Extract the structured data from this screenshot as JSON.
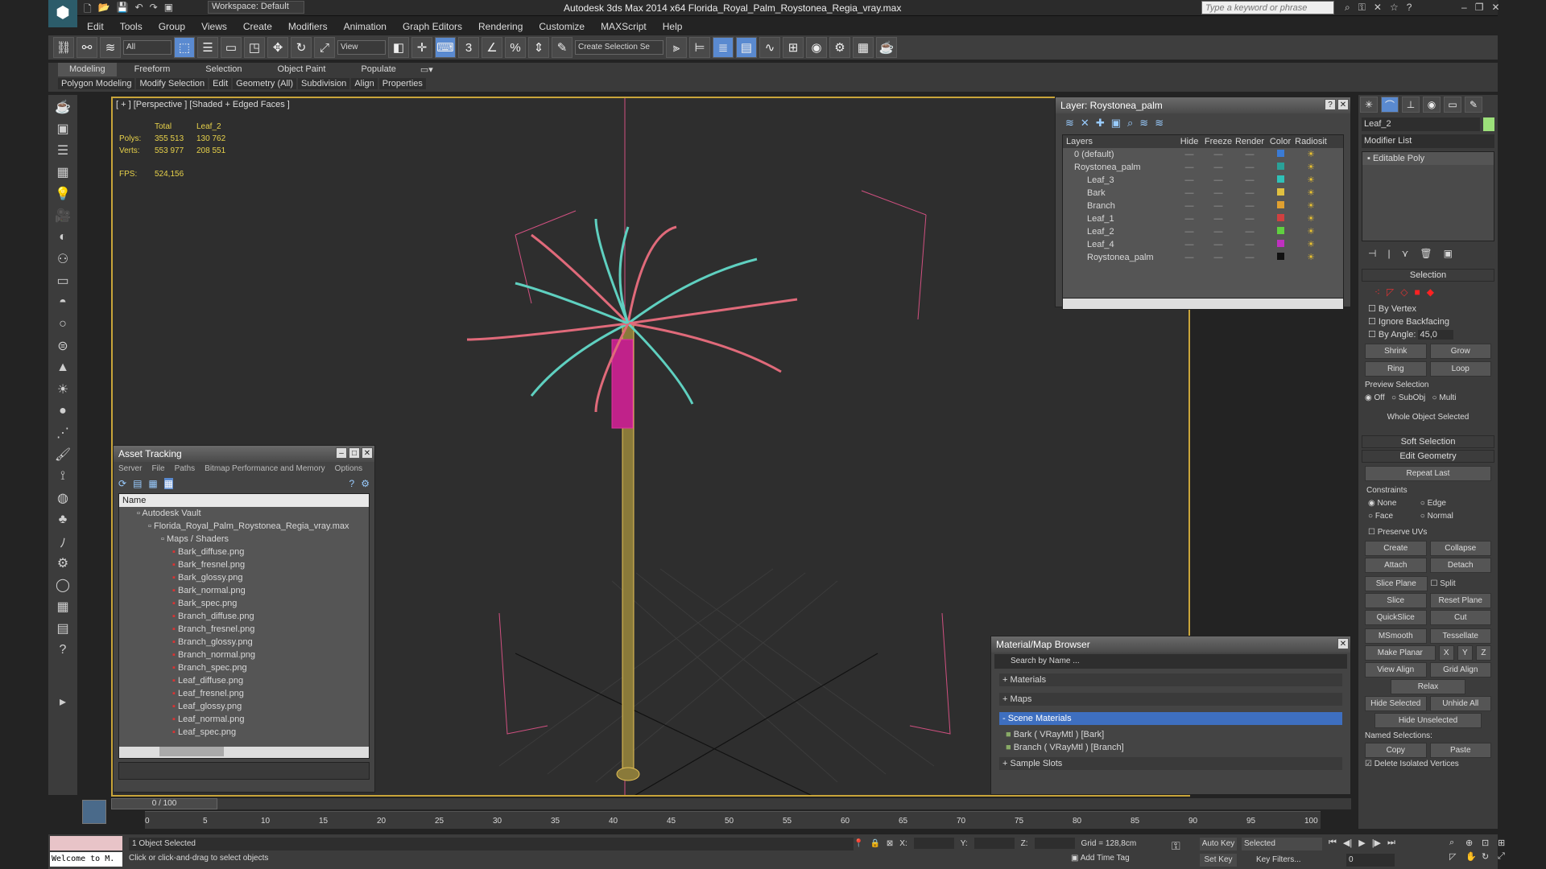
{
  "app": {
    "title": "Autodesk 3ds Max  2014 x64     Florida_Royal_Palm_Roystonea_Regia_vray.max",
    "workspace": "Workspace: Default",
    "search_placeholder": "Type a keyword or phrase"
  },
  "menu": [
    "Edit",
    "Tools",
    "Group",
    "Views",
    "Create",
    "Modifiers",
    "Animation",
    "Graph Editors",
    "Rendering",
    "Customize",
    "MAXScript",
    "Help"
  ],
  "toolbar": {
    "filter": "All",
    "view": "View",
    "selection_set": "Create Selection Se"
  },
  "ribbon": {
    "tabs": [
      "Modeling",
      "Freeform",
      "Selection",
      "Object Paint",
      "Populate"
    ],
    "items": [
      "Polygon Modeling",
      "Modify Selection",
      "Edit",
      "Geometry (All)",
      "Subdivision",
      "Align",
      "Properties"
    ]
  },
  "viewport": {
    "label": "[ + ] [Perspective ] [Shaded + Edged Faces ]",
    "stats": {
      "h_total": "Total",
      "h_leaf": "Leaf_2",
      "polys_label": "Polys:",
      "polys_total": "355 513",
      "polys_leaf": "130 762",
      "verts_label": "Verts:",
      "verts_total": "553 977",
      "verts_leaf": "208 551",
      "fps_label": "FPS:",
      "fps": "524,156"
    }
  },
  "layer_dialog": {
    "title": "Layer: Roystonea_palm",
    "cols": [
      "Layers",
      "Hide",
      "Freeze",
      "Render",
      "Color",
      "Radiosit"
    ],
    "rows": [
      {
        "name": "0 (default)",
        "color": "#3a7bd5",
        "indent": 0
      },
      {
        "name": "Roystonea_palm",
        "color": "#2aa198",
        "indent": 0
      },
      {
        "name": "Leaf_3",
        "color": "#2fc1b8",
        "indent": 1
      },
      {
        "name": "Bark",
        "color": "#e0c040",
        "indent": 1
      },
      {
        "name": "Branch",
        "color": "#e0a030",
        "indent": 1
      },
      {
        "name": "Leaf_1",
        "color": "#d04040",
        "indent": 1
      },
      {
        "name": "Leaf_2",
        "color": "#60d040",
        "indent": 1
      },
      {
        "name": "Leaf_4",
        "color": "#c030c0",
        "indent": 1
      },
      {
        "name": "Roystonea_palm",
        "color": "#111111",
        "indent": 1
      }
    ]
  },
  "asset_tracking": {
    "title": "Asset Tracking",
    "menu": [
      "Server",
      "File",
      "Paths",
      "Bitmap Performance and Memory",
      "Options"
    ],
    "col": "Name",
    "vault": "Autodesk Vault",
    "file": "Florida_Royal_Palm_Roystonea_Regia_vray.max",
    "maps": "Maps / Shaders",
    "files": [
      "Bark_diffuse.png",
      "Bark_fresnel.png",
      "Bark_glossy.png",
      "Bark_normal.png",
      "Bark_spec.png",
      "Branch_diffuse.png",
      "Branch_fresnel.png",
      "Branch_glossy.png",
      "Branch_normal.png",
      "Branch_spec.png",
      "Leaf_diffuse.png",
      "Leaf_fresnel.png",
      "Leaf_glossy.png",
      "Leaf_normal.png",
      "Leaf_spec.png"
    ]
  },
  "material_browser": {
    "title": "Material/Map Browser",
    "search": "Search by Name ...",
    "groups": [
      "+ Materials",
      "+ Maps",
      "- Scene Materials"
    ],
    "items": [
      "Bark  ( VRayMtl )  [Bark]",
      "Branch  ( VRayMtl )  [Branch]"
    ],
    "sample": "+ Sample Slots"
  },
  "command_panel": {
    "object_name": "Leaf_2",
    "modifier_list": "Modifier List",
    "stack_item": "Editable Poly",
    "selection": {
      "header": "Selection",
      "by_vertex": "By Vertex",
      "ignore_backfacing": "Ignore Backfacing",
      "by_angle": "By Angle:",
      "angle": "45,0",
      "shrink": "Shrink",
      "grow": "Grow",
      "ring": "Ring",
      "loop": "Loop",
      "preview": "Preview Selection",
      "off": "Off",
      "subobj": "SubObj",
      "multi": "Multi",
      "whole": "Whole Object Selected"
    },
    "soft_selection": "Soft Selection",
    "edit_geometry": "Edit Geometry",
    "repeat_last": "Repeat Last",
    "constraints": "Constraints",
    "none": "None",
    "edge": "Edge",
    "face": "Face",
    "normal": "Normal",
    "preserve_uvs": "Preserve UVs",
    "create": "Create",
    "collapse": "Collapse",
    "attach": "Attach",
    "detach": "Detach",
    "slice_plane": "Slice Plane",
    "split": "Split",
    "slice": "Slice",
    "reset_plane": "Reset Plane",
    "quickslice": "QuickSlice",
    "cut": "Cut",
    "msmooth": "MSmooth",
    "tessellate": "Tessellate",
    "make_planar": "Make Planar",
    "x": "X",
    "y": "Y",
    "z": "Z",
    "view_align": "View Align",
    "grid_align": "Grid Align",
    "relax": "Relax",
    "hide_selected": "Hide Selected",
    "unhide_all": "Unhide All",
    "hide_unselected": "Hide Unselected",
    "named_sel": "Named Selections:",
    "copy": "Copy",
    "paste": "Paste",
    "delete_isolated": "Delete Isolated Vertices"
  },
  "timeline": {
    "frame": "0 / 100",
    "ticks": [
      "0",
      "5",
      "10",
      "15",
      "20",
      "25",
      "30",
      "35",
      "40",
      "45",
      "50",
      "55",
      "60",
      "65",
      "70",
      "75",
      "80",
      "85",
      "90",
      "95",
      "100"
    ]
  },
  "status": {
    "selected": "1 Object Selected",
    "prompt": "Click or click-and-drag to select objects",
    "maxscript": "Welcome to M.",
    "x": "X:",
    "y": "Y:",
    "z": "Z:",
    "grid": "Grid = 128,8cm",
    "add_time_tag": "Add Time Tag",
    "auto_key": "Auto Key",
    "set_key": "Set Key",
    "selected_dd": "Selected",
    "key_filters": "Key Filters...",
    "frame": "0"
  }
}
